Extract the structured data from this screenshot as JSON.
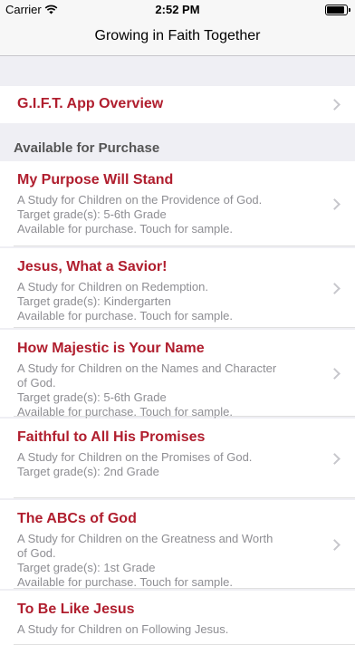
{
  "status": {
    "carrier": "Carrier",
    "time": "2:52 PM"
  },
  "nav": {
    "title": "Growing in Faith Together"
  },
  "overview": {
    "label": "G.I.F.T. App Overview"
  },
  "section": {
    "header": "Available for Purchase"
  },
  "studies": [
    {
      "title": "My Purpose Will Stand",
      "lines": [
        "A Study for Children on the Providence of God.",
        "Target grade(s): 5-6th Grade",
        "Available for purchase. Touch for sample."
      ]
    },
    {
      "title": "Jesus, What a Savior!",
      "lines": [
        "A Study for Children on Redemption.",
        "Target grade(s): Kindergarten",
        "Available for purchase. Touch for sample."
      ]
    },
    {
      "title": "How Majestic is Your Name",
      "lines": [
        "A Study for Children on the Names and Character",
        "of God.",
        "Target grade(s): 5-6th Grade",
        "Available for purchase. Touch for sample."
      ]
    },
    {
      "title": "Faithful to All His Promises",
      "lines": [
        "A Study for Children on the Promises of God.",
        "Target grade(s): 2nd Grade"
      ]
    },
    {
      "title": "The ABCs of God",
      "lines": [
        "A Study for Children on the Greatness and Worth",
        "of God.",
        "Target grade(s): 1st Grade",
        "Available for purchase. Touch for sample."
      ]
    },
    {
      "title": "To Be Like Jesus",
      "lines": [
        "A Study for Children on Following Jesus."
      ]
    }
  ],
  "colors": {
    "title_red": "#b01e2e",
    "subtitle_gray": "#8e8e93",
    "background": "#efeff4"
  }
}
